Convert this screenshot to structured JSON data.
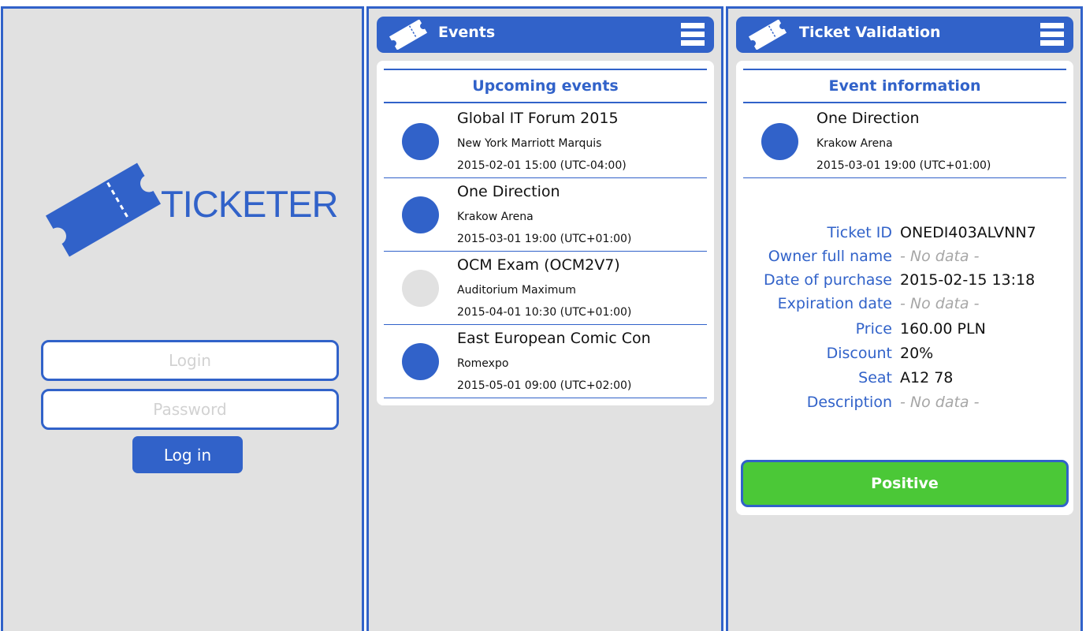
{
  "login": {
    "brand": "TICKETER",
    "login_placeholder": "Login",
    "password_placeholder": "Password",
    "button_label": "Log in"
  },
  "events": {
    "header_title": "Events",
    "section_title": "Upcoming events",
    "items": [
      {
        "name": "Global IT Forum 2015",
        "venue": "New York Marriott Marquis",
        "date": "2015-02-01 15:00 (UTC-04:00)",
        "status_color": "#3162c9"
      },
      {
        "name": "One Direction",
        "venue": "Krakow Arena",
        "date": "2015-03-01 19:00 (UTC+01:00)",
        "status_color": "#3162c9"
      },
      {
        "name": "OCM Exam (OCM2V7)",
        "venue": "Auditorium Maximum",
        "date": "2015-04-01 10:30 (UTC+01:00)",
        "status_color": "#e1e1e1"
      },
      {
        "name": "East European Comic Con",
        "venue": "Romexpo",
        "date": "2015-05-01 09:00 (UTC+02:00)",
        "status_color": "#3162c9"
      }
    ]
  },
  "ticket": {
    "header_title": "Ticket Validation",
    "section_title": "Event information",
    "event": {
      "name": "One Direction",
      "venue": "Krakow Arena",
      "date": "2015-03-01 19:00 (UTC+01:00)"
    },
    "details": [
      {
        "label": "Ticket ID",
        "value": "ONEDI403ALVNN7"
      },
      {
        "label": "Owner full name",
        "value": "- No data -"
      },
      {
        "label": "Date of purchase",
        "value": "2015-02-15 13:18"
      },
      {
        "label": "Expiration date",
        "value": "- No data -"
      },
      {
        "label": "Price",
        "value": "160.00 PLN"
      },
      {
        "label": "Discount",
        "value": "20%"
      },
      {
        "label": "Seat",
        "value": "A12 78"
      },
      {
        "label": "Description",
        "value": "- No data -"
      }
    ],
    "result_label": "Positive"
  },
  "icons": {
    "header": "ticket-icon",
    "menu": "hamburger-menu-icon",
    "logo": "ticket-logo-icon"
  },
  "colors": {
    "accent": "#3162c9",
    "background": "#e1e1e1",
    "positive": "#4bc837",
    "no_data": "#a6a6a6"
  }
}
